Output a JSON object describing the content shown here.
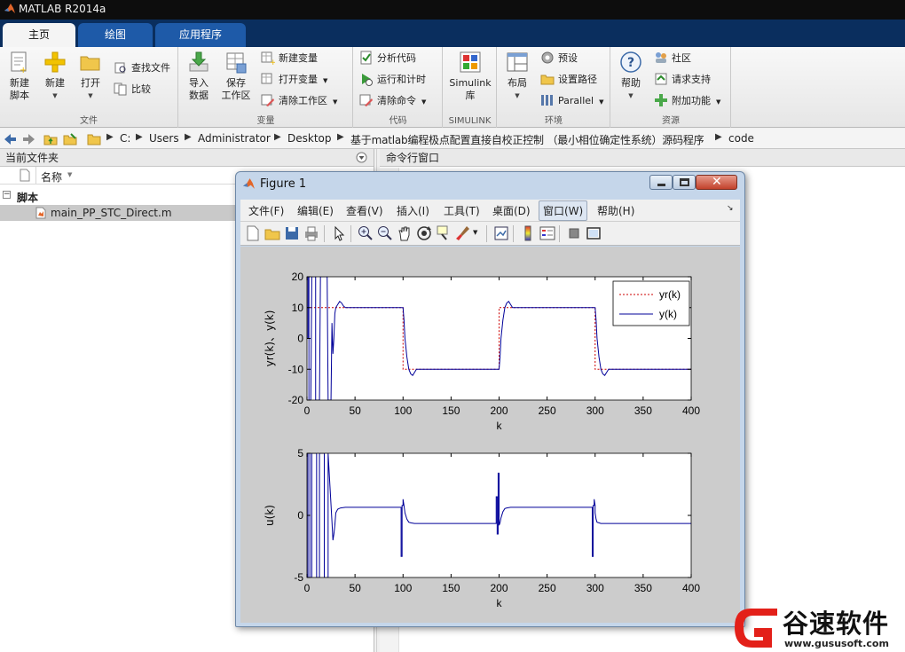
{
  "app": {
    "title": "MATLAB R2014a"
  },
  "ribbon_tabs": [
    "主页",
    "绘图",
    "应用程序"
  ],
  "ribbon": {
    "file": {
      "new_script": [
        "新建",
        "脚本"
      ],
      "new": "新建",
      "open": "打开",
      "find_files": "查找文件",
      "compare": "比较",
      "label": "文件"
    },
    "variable": {
      "import": [
        "导入",
        "数据"
      ],
      "save_ws": [
        "保存",
        "工作区"
      ],
      "new_var": "新建变量",
      "open_var": "打开变量",
      "clear_ws": "清除工作区",
      "label": "变量"
    },
    "code": {
      "analyze": "分析代码",
      "run_time": "运行和计时",
      "clear_cmd": "清除命令",
      "label": "代码"
    },
    "simulink": {
      "button": [
        "Simulink",
        "库"
      ],
      "label": "SIMULINK"
    },
    "environment": {
      "layout": "布局",
      "prefs": "预设",
      "set_path": "设置路径",
      "parallel": "Parallel",
      "label": "环境"
    },
    "resources": {
      "help": "帮助",
      "community": "社区",
      "request_support": "请求支持",
      "addons": "附加功能",
      "label": "资源"
    }
  },
  "address": {
    "crumbs": [
      "C:",
      "Users",
      "Administrator",
      "Desktop",
      "基于matlab编程极点配置直接自校正控制 （最小相位确定性系统）源码程序",
      "code"
    ]
  },
  "current_folder": {
    "title": "当前文件夹",
    "column_name": "名称",
    "group": "脚本",
    "file": "main_PP_STC_Direct.m"
  },
  "command_window": {
    "title": "命令行窗口"
  },
  "figure": {
    "title": "Figure 1",
    "menus": [
      "文件(F)",
      "编辑(E)",
      "查看(V)",
      "插入(I)",
      "工具(T)",
      "桌面(D)",
      "窗口(W)",
      "帮助(H)"
    ]
  },
  "chart_data": [
    {
      "type": "line",
      "xlabel": "k",
      "ylabel": "yr(k)、y(k)",
      "xlim": [
        0,
        400
      ],
      "ylim": [
        -20,
        20
      ],
      "xticks": [
        0,
        50,
        100,
        150,
        200,
        250,
        300,
        350,
        400
      ],
      "yticks": [
        -20,
        -10,
        0,
        10,
        20
      ],
      "legend": [
        "yr(k)",
        "y(k)"
      ],
      "legend_position": "top-right",
      "series": [
        {
          "name": "yr(k)",
          "color": "#cc0000",
          "dash": true,
          "x": [
            0,
            100,
            100,
            200,
            200,
            300,
            300,
            400
          ],
          "y": [
            10,
            10,
            -10,
            -10,
            10,
            10,
            -10,
            -10
          ]
        },
        {
          "name": "y(k)",
          "color": "#000099",
          "dash": false,
          "x": [
            1,
            1,
            2,
            2,
            3,
            4,
            5,
            6,
            7,
            8,
            9,
            9,
            10,
            11,
            12,
            13,
            14,
            15,
            16,
            17,
            18,
            19,
            20,
            21,
            22,
            23,
            24,
            25,
            26,
            27,
            28,
            29,
            30,
            32,
            34,
            36,
            38,
            40,
            45,
            100,
            101,
            102,
            104,
            106,
            108,
            110,
            112,
            114,
            120,
            200,
            201,
            202,
            204,
            206,
            208,
            210,
            212,
            214,
            220,
            300,
            301,
            302,
            304,
            306,
            308,
            310,
            312,
            314,
            320,
            400
          ],
          "y": [
            0,
            20,
            20,
            -20,
            -20,
            -20,
            20,
            20,
            20,
            20,
            20,
            -20,
            -20,
            -20,
            -20,
            -20,
            20,
            20,
            20,
            20,
            20,
            20,
            20,
            20,
            -20,
            -20,
            -20,
            -20,
            5,
            -5,
            0,
            8,
            10,
            11,
            12,
            11.5,
            10.5,
            10,
            10,
            10,
            6,
            0,
            -6,
            -10,
            -11.5,
            -12,
            -11,
            -10,
            -10,
            -10,
            -6,
            0,
            6,
            10,
            11.5,
            12,
            11,
            10,
            10,
            10,
            6,
            0,
            -6,
            -10,
            -11.5,
            -12,
            -11,
            -10,
            -10,
            -10
          ]
        }
      ]
    },
    {
      "type": "line",
      "xlabel": "k",
      "ylabel": "u(k)",
      "xlim": [
        0,
        400
      ],
      "ylim": [
        -5,
        5
      ],
      "xticks": [
        0,
        50,
        100,
        150,
        200,
        250,
        300,
        350,
        400
      ],
      "yticks": [
        -5,
        0,
        5
      ],
      "series": [
        {
          "name": "",
          "color": "#000099",
          "dash": false,
          "x": [
            1,
            1,
            3,
            3,
            5,
            5,
            10,
            10,
            13,
            13,
            18,
            18,
            22,
            22,
            26,
            27,
            28,
            29,
            30,
            32,
            35,
            40,
            60,
            98,
            98,
            99,
            99,
            100,
            100,
            101,
            102,
            104,
            106,
            108,
            112,
            120,
            196,
            197,
            197,
            198,
            198,
            199,
            199,
            200,
            200,
            201,
            202,
            204,
            206,
            208,
            212,
            220,
            296,
            297,
            297,
            298,
            298,
            299,
            299,
            300,
            300,
            301,
            302,
            304,
            306,
            308,
            312,
            320,
            400
          ],
          "y": [
            -5,
            5,
            5,
            -5,
            -5,
            5,
            5,
            -5,
            -5,
            5,
            5,
            -5,
            -5,
            5,
            -0.5,
            -2,
            -1.5,
            -0.8,
            0.2,
            0.5,
            0.6,
            0.65,
            0.65,
            0.65,
            -3.3,
            -3.3,
            0.8,
            0.8,
            1.3,
            0.8,
            0.2,
            -0.3,
            -0.55,
            -0.6,
            -0.65,
            -0.65,
            -0.65,
            -0.65,
            1.5,
            1.5,
            -1.5,
            -1.5,
            3.4,
            3.4,
            -0.8,
            -0.6,
            -0.2,
            0.3,
            0.55,
            0.6,
            0.65,
            0.65,
            0.65,
            0.65,
            -3.3,
            -3.3,
            0.8,
            0.8,
            1.3,
            0.8,
            0.2,
            -0.3,
            -0.55,
            -0.6,
            -0.65,
            -0.65,
            -0.65,
            -0.65,
            -0.65
          ]
        }
      ]
    }
  ],
  "watermark": {
    "brand": "谷速软件",
    "url": "www.gususoft.com"
  }
}
